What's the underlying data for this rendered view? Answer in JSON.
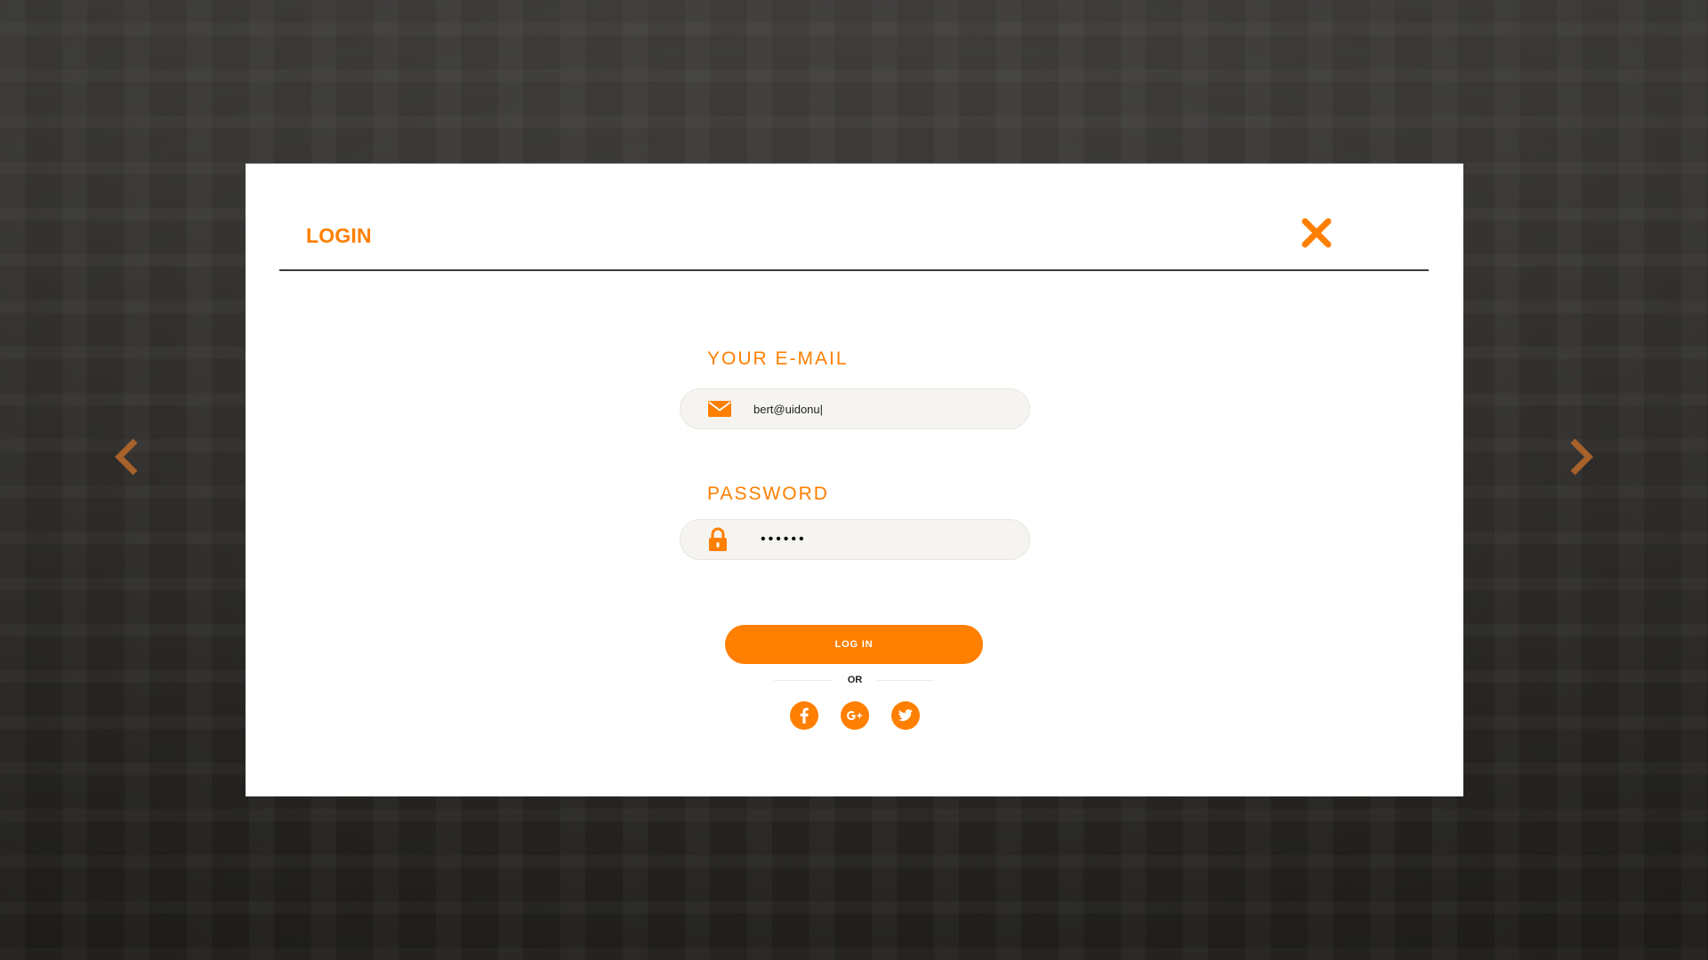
{
  "modal": {
    "title": "LOGIN"
  },
  "form": {
    "email_label": "YOUR E-MAIL",
    "email_value": "bert@uidonu|",
    "password_label": "PASSWORD",
    "password_value": "••••••",
    "login_button": "LOG IN",
    "or_text": "OR"
  },
  "icons": {
    "prev": "chevron-left-icon",
    "next": "chevron-right-icon",
    "close": "close-icon",
    "email": "envelope-icon",
    "password": "lock-icon",
    "facebook": "facebook-icon",
    "google": "google-plus-icon",
    "twitter": "twitter-icon"
  },
  "colors": {
    "accent": "#ff7f00",
    "field_background": "#f6f4f0",
    "divider": "#3a3a3a"
  }
}
